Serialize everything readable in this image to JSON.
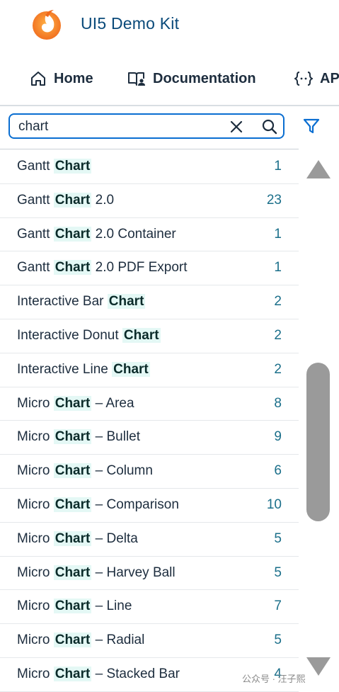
{
  "app": {
    "title": "UI5 Demo Kit"
  },
  "nav": {
    "home": "Home",
    "documentation": "Documentation",
    "api": "API"
  },
  "search": {
    "value": "chart"
  },
  "results": [
    {
      "before": "Gantt ",
      "match": "Chart",
      "after": "",
      "count": "1"
    },
    {
      "before": "Gantt ",
      "match": "Chart",
      "after": " 2.0",
      "count": "23"
    },
    {
      "before": "Gantt ",
      "match": "Chart",
      "after": " 2.0 Container",
      "count": "1"
    },
    {
      "before": "Gantt ",
      "match": "Chart",
      "after": " 2.0 PDF Export",
      "count": "1"
    },
    {
      "before": "Interactive Bar ",
      "match": "Chart",
      "after": "",
      "count": "2"
    },
    {
      "before": "Interactive Donut ",
      "match": "Chart",
      "after": "",
      "count": "2"
    },
    {
      "before": "Interactive Line ",
      "match": "Chart",
      "after": "",
      "count": "2"
    },
    {
      "before": "Micro ",
      "match": "Chart",
      "after": " – Area",
      "count": "8"
    },
    {
      "before": "Micro ",
      "match": "Chart",
      "after": " – Bullet",
      "count": "9"
    },
    {
      "before": "Micro ",
      "match": "Chart",
      "after": " – Column",
      "count": "6"
    },
    {
      "before": "Micro ",
      "match": "Chart",
      "after": " – Comparison",
      "count": "10"
    },
    {
      "before": "Micro ",
      "match": "Chart",
      "after": " – Delta",
      "count": "5"
    },
    {
      "before": "Micro ",
      "match": "Chart",
      "after": " – Harvey Ball",
      "count": "5"
    },
    {
      "before": "Micro ",
      "match": "Chart",
      "after": " – Line",
      "count": "7"
    },
    {
      "before": "Micro ",
      "match": "Chart",
      "after": " – Radial",
      "count": "5"
    },
    {
      "before": "Micro ",
      "match": "Chart",
      "after": " – Stacked Bar",
      "count": "4"
    }
  ],
  "watermark": "公众号 · 汪子熙",
  "colors": {
    "brand_title": "#0a4a7a",
    "search_border": "#0a6ed1",
    "highlight_bg": "#e4f8f5",
    "count_text": "#1b6f8a",
    "scrollbar": "#9a9a9a"
  },
  "icons": {
    "logo": "ui5-logo",
    "home": "home-icon",
    "documentation": "book-person-icon",
    "api": "curly-braces-icon",
    "clear": "close-icon",
    "search": "search-icon",
    "filter": "filter-icon"
  }
}
